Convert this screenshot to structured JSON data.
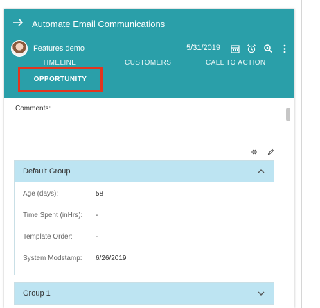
{
  "header": {
    "title": "Automate Email Communications",
    "user_name": "Features demo",
    "date": "5/31/2019",
    "tabs": [
      "TIMELINE",
      "CUSTOMERS",
      "CALL TO ACTION"
    ],
    "active_tab": "OPPORTUNITY",
    "icons": [
      "arrow-right-icon",
      "avatar",
      "calendar-icon",
      "alarm-icon",
      "settings-pin-icon",
      "more-vertical-icon"
    ]
  },
  "content": {
    "comments_label": "Comments:",
    "comments_value": "",
    "toolbar_icons": [
      "collapse-icon",
      "edit-pencil-icon"
    ]
  },
  "groups": [
    {
      "title": "Default Group",
      "expanded": true,
      "fields": [
        {
          "label": "Age (days):",
          "value": "58"
        },
        {
          "label": "Time Spent (inHrs):",
          "value": "-"
        },
        {
          "label": "Template Order:",
          "value": "-"
        },
        {
          "label": "System Modstamp:",
          "value": "6/26/2019"
        }
      ]
    },
    {
      "title": "Group 1",
      "expanded": false,
      "fields": []
    }
  ],
  "colors": {
    "header_bg": "#2a9fa9",
    "highlight_box": "#e2351f",
    "group_header_bg": "#bde4f2"
  }
}
